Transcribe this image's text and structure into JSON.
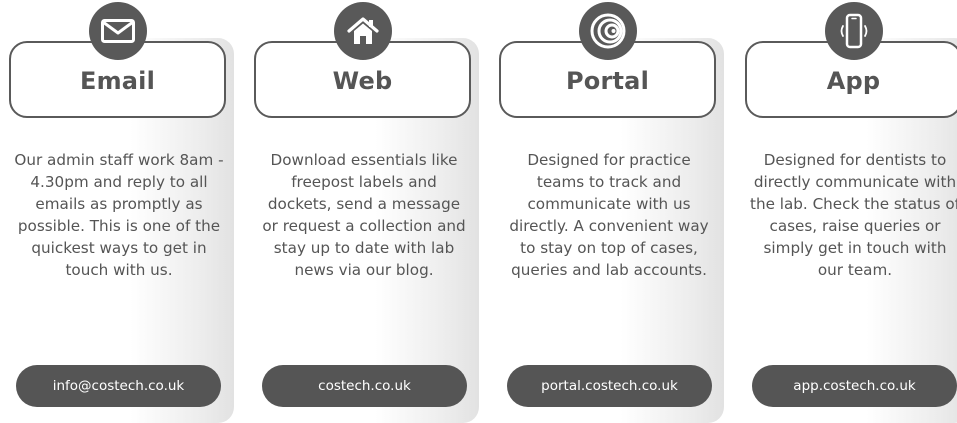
{
  "cards": [
    {
      "title": "Email",
      "icon": "envelope-icon",
      "description": "Our admin staff work 8am - 4.30pm and reply to all emails as promptly as possible. This is one of the quickest ways to get in touch with us.",
      "link": "info@costech.co.uk"
    },
    {
      "title": "Web",
      "icon": "home-icon",
      "description": "Download essentials like freepost labels and dockets, send a message or request a collection and stay up to date with lab news via our blog.",
      "link": "costech.co.uk"
    },
    {
      "title": "Portal",
      "icon": "portal-icon",
      "description": "Designed for practice teams to track and communicate with us directly. A convenient way to stay on top of cases, queries and lab accounts.",
      "link": "portal.costech.co.uk"
    },
    {
      "title": "App",
      "icon": "smartphone-icon",
      "description": "Designed for dentists to directly communicate with the lab. Check the status of cases, raise queries or simply get in touch with our team.",
      "link": "app.costech.co.uk"
    }
  ],
  "colors": {
    "dark_grey": "#555555",
    "border_grey": "#5a5a5a",
    "text_grey": "#555555",
    "card_gradient_end": "#e2e2e2"
  }
}
